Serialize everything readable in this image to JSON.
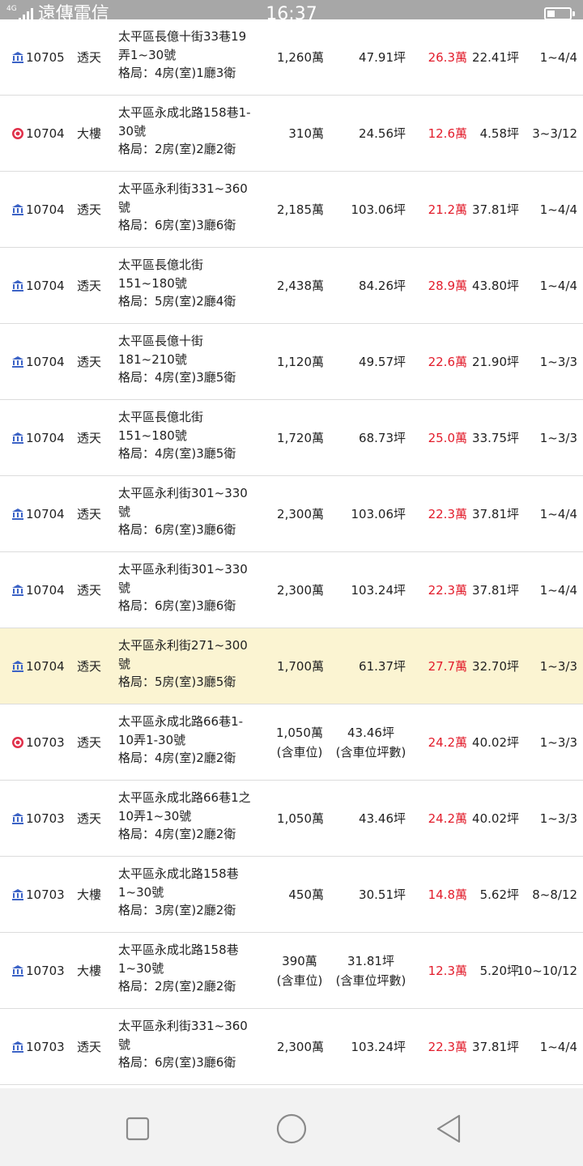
{
  "status_bar": {
    "network": "4G",
    "carrier": "遠傳電信",
    "time": "16:37"
  },
  "listings": [
    {
      "icon": "bank-icon",
      "date": "10705",
      "type": "透天",
      "addr": [
        "太平區長億十街33巷19",
        "弄1~30號",
        "格局：4房(室)1廳3衛"
      ],
      "price": [
        "1,260萬"
      ],
      "area": [
        "47.91坪"
      ],
      "unit_price": "26.3萬",
      "parking_area": "22.41坪",
      "floor": "1~4/4",
      "highlight": false
    },
    {
      "icon": "target-icon",
      "date": "10704",
      "type": "大樓",
      "addr": [
        "太平區永成北路158巷1-",
        "30號",
        "格局：2房(室)2廳2衛"
      ],
      "price": [
        "310萬"
      ],
      "area": [
        "24.56坪"
      ],
      "unit_price": "12.6萬",
      "parking_area": "4.58坪",
      "floor": "3~3/12",
      "highlight": false
    },
    {
      "icon": "bank-icon",
      "date": "10704",
      "type": "透天",
      "addr": [
        "太平區永利街331~360",
        "號",
        "格局：6房(室)3廳6衛"
      ],
      "price": [
        "2,185萬"
      ],
      "area": [
        "103.06坪"
      ],
      "unit_price": "21.2萬",
      "parking_area": "37.81坪",
      "floor": "1~4/4",
      "highlight": false
    },
    {
      "icon": "bank-icon",
      "date": "10704",
      "type": "透天",
      "addr": [
        "太平區長億北街",
        "151~180號",
        "格局：5房(室)2廳4衛"
      ],
      "price": [
        "2,438萬"
      ],
      "area": [
        "84.26坪"
      ],
      "unit_price": "28.9萬",
      "parking_area": "43.80坪",
      "floor": "1~4/4",
      "highlight": false
    },
    {
      "icon": "bank-icon",
      "date": "10704",
      "type": "透天",
      "addr": [
        "太平區長億十街",
        "181~210號",
        "格局：4房(室)3廳5衛"
      ],
      "price": [
        "1,120萬"
      ],
      "area": [
        "49.57坪"
      ],
      "unit_price": "22.6萬",
      "parking_area": "21.90坪",
      "floor": "1~3/3",
      "highlight": false
    },
    {
      "icon": "bank-icon",
      "date": "10704",
      "type": "透天",
      "addr": [
        "太平區長億北街",
        "151~180號",
        "格局：4房(室)3廳5衛"
      ],
      "price": [
        "1,720萬"
      ],
      "area": [
        "68.73坪"
      ],
      "unit_price": "25.0萬",
      "parking_area": "33.75坪",
      "floor": "1~3/3",
      "highlight": false
    },
    {
      "icon": "bank-icon",
      "date": "10704",
      "type": "透天",
      "addr": [
        "太平區永利街301~330",
        "號",
        "格局：6房(室)3廳6衛"
      ],
      "price": [
        "2,300萬"
      ],
      "area": [
        "103.06坪"
      ],
      "unit_price": "22.3萬",
      "parking_area": "37.81坪",
      "floor": "1~4/4",
      "highlight": false
    },
    {
      "icon": "bank-icon",
      "date": "10704",
      "type": "透天",
      "addr": [
        "太平區永利街301~330",
        "號",
        "格局：6房(室)3廳6衛"
      ],
      "price": [
        "2,300萬"
      ],
      "area": [
        "103.24坪"
      ],
      "unit_price": "22.3萬",
      "parking_area": "37.81坪",
      "floor": "1~4/4",
      "highlight": false
    },
    {
      "icon": "bank-icon",
      "date": "10704",
      "type": "透天",
      "addr": [
        "太平區永利街271~300",
        "號",
        "格局：5房(室)3廳5衛"
      ],
      "price": [
        "1,700萬"
      ],
      "area": [
        "61.37坪"
      ],
      "unit_price": "27.7萬",
      "parking_area": "32.70坪",
      "floor": "1~3/3",
      "highlight": true
    },
    {
      "icon": "target-icon",
      "date": "10703",
      "type": "透天",
      "addr": [
        "太平區永成北路66巷1-",
        "10弄1-30號",
        "格局：4房(室)2廳2衛"
      ],
      "price": [
        "1,050萬",
        "(含車位)"
      ],
      "area": [
        "43.46坪",
        "(含車位坪數)"
      ],
      "unit_price": "24.2萬",
      "parking_area": "40.02坪",
      "floor": "1~3/3",
      "highlight": false
    },
    {
      "icon": "bank-icon",
      "date": "10703",
      "type": "透天",
      "addr": [
        "太平區永成北路66巷1之",
        "10弄1~30號",
        "格局：4房(室)2廳2衛"
      ],
      "price": [
        "1,050萬"
      ],
      "area": [
        "43.46坪"
      ],
      "unit_price": "24.2萬",
      "parking_area": "40.02坪",
      "floor": "1~3/3",
      "highlight": false
    },
    {
      "icon": "bank-icon",
      "date": "10703",
      "type": "大樓",
      "addr": [
        "太平區永成北路158巷",
        "1~30號",
        "格局：3房(室)2廳2衛"
      ],
      "price": [
        "450萬"
      ],
      "area": [
        "30.51坪"
      ],
      "unit_price": "14.8萬",
      "parking_area": "5.62坪",
      "floor": "8~8/12",
      "highlight": false
    },
    {
      "icon": "bank-icon",
      "date": "10703",
      "type": "大樓",
      "addr": [
        "太平區永成北路158巷",
        "1~30號",
        "格局：2房(室)2廳2衛"
      ],
      "price": [
        "390萬",
        "(含車位)"
      ],
      "area": [
        "31.81坪",
        "(含車位坪數)"
      ],
      "unit_price": "12.3萬",
      "parking_area": "5.20坪",
      "floor": "10~10/12",
      "highlight": false
    },
    {
      "icon": "bank-icon",
      "date": "10703",
      "type": "透天",
      "addr": [
        "太平區永利街331~360",
        "號",
        "格局：6房(室)3廳6衛"
      ],
      "price": [
        "2,300萬"
      ],
      "area": [
        "103.24坪"
      ],
      "unit_price": "22.3萬",
      "parking_area": "37.81坪",
      "floor": "1~4/4",
      "highlight": false
    }
  ],
  "colors": {
    "accent_red": "#e21c2b",
    "bank_icon_blue": "#3c63c6",
    "target_icon_red": "#e0304a",
    "highlight_row": "#fbf4d2"
  },
  "nav_bar": {
    "icons": [
      "recent-apps-icon",
      "home-icon",
      "back-icon"
    ]
  }
}
